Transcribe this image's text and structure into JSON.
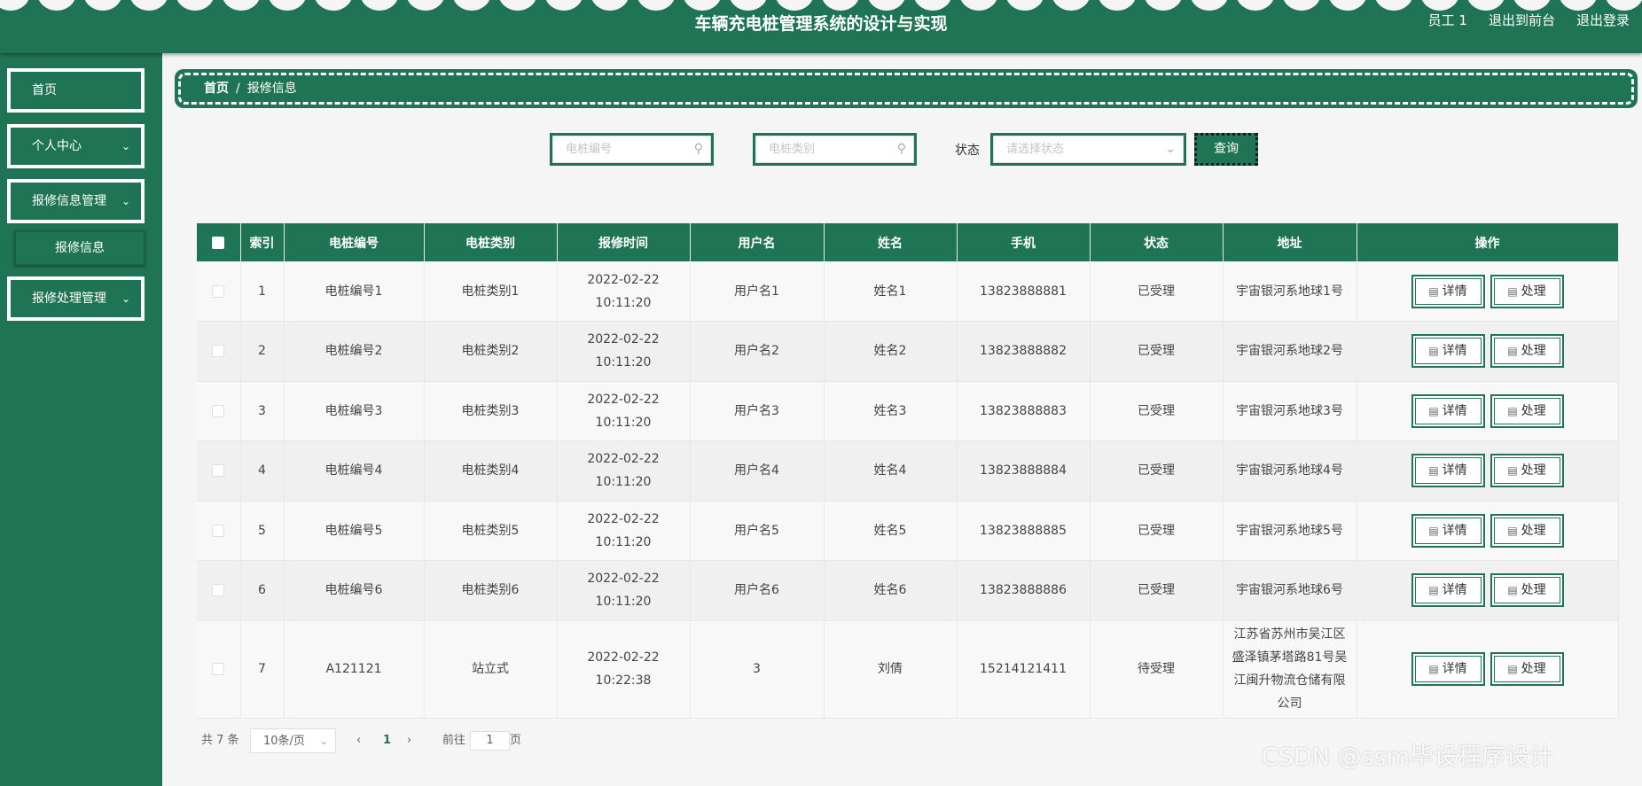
{
  "header": {
    "title": "车辆充电桩管理系统的设计与实现",
    "user": "员工 1",
    "back_to_front": "退出到前台",
    "logout": "退出登录"
  },
  "sidebar": {
    "home": "首页",
    "personal_center": "个人中心",
    "repair_info_mgmt": "报修信息管理",
    "repair_info": "报修信息",
    "repair_process_mgmt": "报修处理管理"
  },
  "breadcrumb": {
    "home": "首页",
    "separator": "/",
    "current": "报修信息"
  },
  "search": {
    "pile_no_placeholder": "电桩编号",
    "pile_type_placeholder": "电桩类别",
    "status_label": "状态",
    "status_placeholder": "请选择状态",
    "query_label": "查询"
  },
  "table": {
    "headers": [
      "索引",
      "电桩编号",
      "电桩类别",
      "报修时间",
      "用户名",
      "姓名",
      "手机",
      "状态",
      "地址",
      "操作"
    ],
    "rows": [
      {
        "index": "1",
        "pile_no": "电桩编号1",
        "pile_type": "电桩类别1",
        "time": "2022-02-22 10:11:20",
        "username": "用户名1",
        "name": "姓名1",
        "phone": "13823888881",
        "status": "已受理",
        "address": "宇宙银河系地球1号"
      },
      {
        "index": "2",
        "pile_no": "电桩编号2",
        "pile_type": "电桩类别2",
        "time": "2022-02-22 10:11:20",
        "username": "用户名2",
        "name": "姓名2",
        "phone": "13823888882",
        "status": "已受理",
        "address": "宇宙银河系地球2号"
      },
      {
        "index": "3",
        "pile_no": "电桩编号3",
        "pile_type": "电桩类别3",
        "time": "2022-02-22 10:11:20",
        "username": "用户名3",
        "name": "姓名3",
        "phone": "13823888883",
        "status": "已受理",
        "address": "宇宙银河系地球3号"
      },
      {
        "index": "4",
        "pile_no": "电桩编号4",
        "pile_type": "电桩类别4",
        "time": "2022-02-22 10:11:20",
        "username": "用户名4",
        "name": "姓名4",
        "phone": "13823888884",
        "status": "已受理",
        "address": "宇宙银河系地球4号"
      },
      {
        "index": "5",
        "pile_no": "电桩编号5",
        "pile_type": "电桩类别5",
        "time": "2022-02-22 10:11:20",
        "username": "用户名5",
        "name": "姓名5",
        "phone": "13823888885",
        "status": "已受理",
        "address": "宇宙银河系地球5号"
      },
      {
        "index": "6",
        "pile_no": "电桩编号6",
        "pile_type": "电桩类别6",
        "time": "2022-02-22 10:11:20",
        "username": "用户名6",
        "name": "姓名6",
        "phone": "13823888886",
        "status": "已受理",
        "address": "宇宙银河系地球6号"
      },
      {
        "index": "7",
        "pile_no": "A121121",
        "pile_type": "站立式",
        "time": "2022-02-22 10:22:38",
        "username": "3",
        "name": "刘倩",
        "phone": "15214121411",
        "status": "待受理",
        "address": "江苏省苏州市吴江区盛泽镇茅塔路81号吴江闽升物流仓储有限公司"
      }
    ],
    "detail_label": "详情",
    "process_label": "处理"
  },
  "pagination": {
    "total": "共 7 条",
    "page_size": "10条/页",
    "prev": "‹",
    "current_page": "1",
    "next": "›",
    "goto_label": "前往",
    "goto_value": "1",
    "page_suffix": "页"
  },
  "watermark": "CSDN @ssm毕设程序设计",
  "colors": {
    "primary": "#207456",
    "background": "#f5f5f5"
  }
}
